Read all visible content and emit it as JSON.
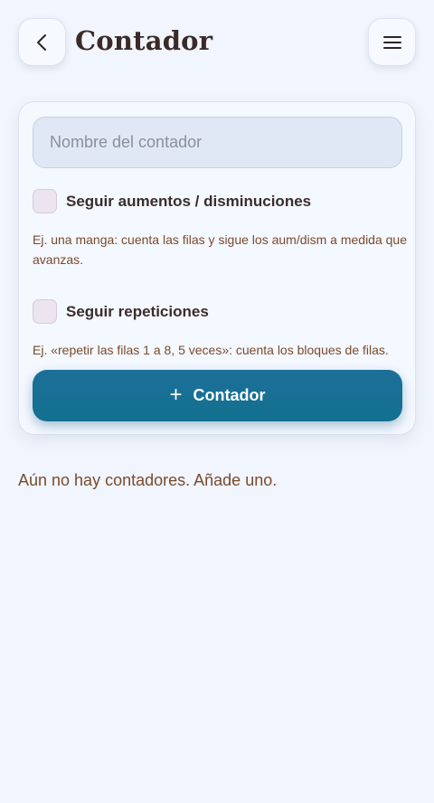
{
  "header": {
    "title": "Contador",
    "back_icon": "chevron-left-icon",
    "menu_icon": "hamburger-menu-icon"
  },
  "form": {
    "name_placeholder": "Nombre del contador",
    "name_value": "",
    "track_increases_label": "Seguir aumentos / disminuciones",
    "track_increases_checked": false,
    "track_increases_hint": "Ej. una manga: cuenta las filas y sigue los aum/dism a medida que avanzas.",
    "track_repeats_label": "Seguir repeticiones",
    "track_repeats_checked": false,
    "track_repeats_hint": "Ej. «repetir las filas 1 a 8, 5 veces»: cuenta los bloques de filas.",
    "add_button_label": "Contador",
    "add_button_icon": "plus-icon"
  },
  "empty_state": {
    "message": "Aún no hay contadores. Añade uno."
  },
  "colors": {
    "background": "#f1f5fd",
    "accent": "#1a6f95",
    "title_text": "#3b2a26",
    "hint_text": "#7a4a2c"
  }
}
